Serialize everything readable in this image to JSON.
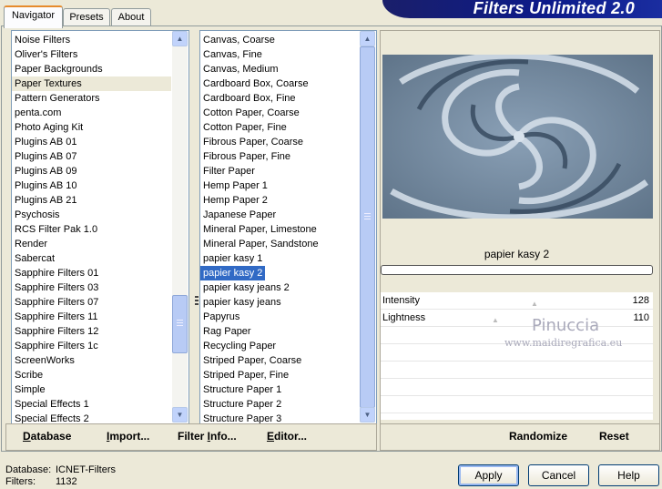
{
  "app": {
    "title": "Filters Unlimited 2.0"
  },
  "tabs": [
    {
      "label": "Navigator"
    },
    {
      "label": "Presets"
    },
    {
      "label": "About"
    }
  ],
  "categories": [
    "Noise Filters",
    "Oliver's Filters",
    "Paper Backgrounds",
    "Paper Textures",
    "Pattern Generators",
    "penta.com",
    "Photo Aging Kit",
    "Plugins AB 01",
    "Plugins AB 07",
    "Plugins AB 09",
    "Plugins AB 10",
    "Plugins AB 21",
    "Psychosis",
    "RCS Filter Pak 1.0",
    "Render",
    "Sabercat",
    "Sapphire Filters 01",
    "Sapphire Filters 03",
    "Sapphire Filters 07",
    "Sapphire Filters 11",
    "Sapphire Filters 12",
    "Sapphire Filters 1c",
    "ScreenWorks",
    "Scribe",
    "Simple",
    "Special Effects 1",
    "Special Effects 2"
  ],
  "filters": [
    "Canvas, Coarse",
    "Canvas, Fine",
    "Canvas, Medium",
    "Cardboard Box, Coarse",
    "Cardboard Box, Fine",
    "Cotton Paper, Coarse",
    "Cotton Paper, Fine",
    "Fibrous Paper, Coarse",
    "Fibrous Paper, Fine",
    "Filter Paper",
    "Hemp Paper 1",
    "Hemp Paper 2",
    "Japanese Paper",
    "Mineral Paper, Limestone",
    "Mineral Paper, Sandstone",
    "papier kasy 1",
    "papier kasy 2",
    "papier kasy jeans 2",
    "papier kasy jeans",
    "Papyrus",
    "Rag Paper",
    "Recycling Paper",
    "Striped Paper, Coarse",
    "Striped Paper, Fine",
    "Structure Paper 1",
    "Structure Paper 2",
    "Structure Paper 3"
  ],
  "selected_category": "Paper Textures",
  "selected_filter": "papier kasy 2",
  "left_buttons": {
    "database": "Database",
    "import": "Import...",
    "filter_info": "Filter Info...",
    "editor": "Editor..."
  },
  "right_buttons": {
    "randomize": "Randomize",
    "reset": "Reset"
  },
  "preview": {
    "filter_name": "papier kasy 2"
  },
  "params": [
    {
      "label": "Intensity",
      "value": "128"
    },
    {
      "label": "Lightness",
      "value": "110"
    }
  ],
  "watermark": {
    "name": "Pinuccia",
    "site": "www.maidiregrafica.eu"
  },
  "status": {
    "db_label": "Database:",
    "db_value": "ICNET-Filters",
    "filters_label": "Filters:",
    "filters_value": "1132"
  },
  "dialog_buttons": {
    "apply": "Apply",
    "cancel": "Cancel",
    "help": "Help"
  }
}
